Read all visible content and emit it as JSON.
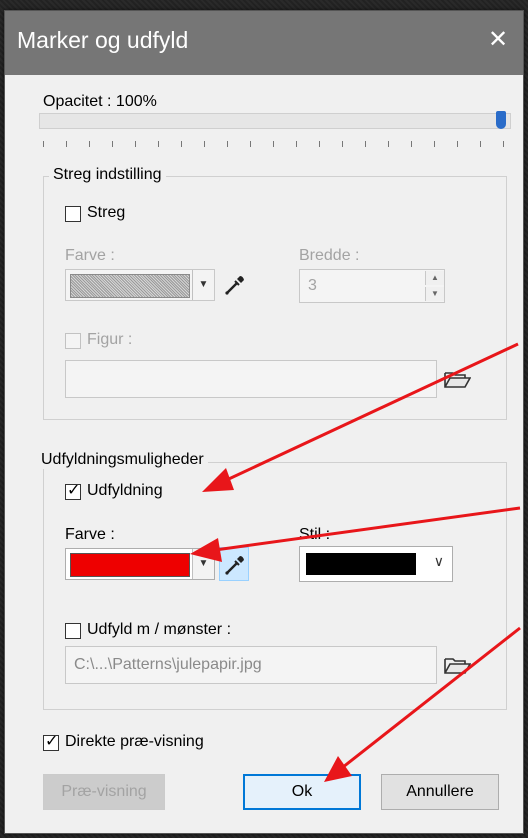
{
  "window": {
    "title": "Marker og udfyld",
    "close_glyph": "✕"
  },
  "opacity": {
    "label": "Opacitet : 100%",
    "value_percent": 100
  },
  "stroke_group": {
    "legend": "Streg indstilling",
    "stroke_checkbox": {
      "label": "Streg",
      "checked": false
    },
    "color_label": "Farve :",
    "width_label": "Bredde :",
    "width_value": "3",
    "figure_checkbox": {
      "label": "Figur :",
      "checked": false
    },
    "figure_path": ""
  },
  "fill_group": {
    "legend": "Udfyldningsmuligheder",
    "fill_checkbox": {
      "label": "Udfyldning",
      "checked": true
    },
    "color_label": "Farve :",
    "style_label": "Stil :",
    "fill_color": "#ee0000",
    "style_color": "#000000",
    "pattern_checkbox": {
      "label": "Udfyld m / mønster :",
      "checked": false
    },
    "pattern_path": "C:\\...\\Patterns\\julepapir.jpg"
  },
  "direct_preview": {
    "label": "Direkte præ-visning",
    "checked": true
  },
  "buttons": {
    "preview": "Præ-visning",
    "ok": "Ok",
    "cancel": "Annullere"
  },
  "icons": [
    "eyedropper-icon",
    "folder-open-icon",
    "chevron-down-icon",
    "check-icon"
  ],
  "colors": {
    "accent": "#0078d7",
    "annotation_arrow": "#e8161a",
    "titlebar": "#767676"
  }
}
